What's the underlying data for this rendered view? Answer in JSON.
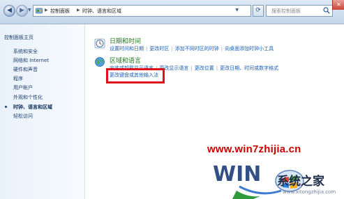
{
  "toolbar": {
    "breadcrumb": [
      "控制面板",
      "时钟、语言和区域"
    ],
    "search_placeholder": "搜索控制面板",
    "close_glyph": "✕",
    "back_glyph": "◀",
    "forward_glyph": "▶",
    "refresh_glyph": "⟳"
  },
  "sidebar": {
    "home": "控制面板主页",
    "items": [
      {
        "label": "系统和安全"
      },
      {
        "label": "网络和 Internet"
      },
      {
        "label": "硬件和声音"
      },
      {
        "label": "程序"
      },
      {
        "label": "用户帐户"
      },
      {
        "label": "外观和个性化"
      },
      {
        "label": "时钟、语言和区域",
        "current": true
      },
      {
        "label": "轻松访问"
      }
    ]
  },
  "categories": [
    {
      "title": "日期和时间",
      "icon": "clock-icon",
      "links": [
        "设置时间和日期",
        "更改时区",
        "添加不同时区的时钟",
        "向桌面添加时钟小工具"
      ]
    },
    {
      "title": "区域和语言",
      "icon": "globe-icon",
      "links": [
        "安装或卸载显示语言",
        "更改显示语言",
        "更改位置",
        "更改日期、时间或数字格式"
      ],
      "highlighted_link": "更改键盘或其他输入法"
    }
  ],
  "highlight_color": "#e0101a",
  "watermark": {
    "url": "www.win7zhijia.cn",
    "brand": "系统之家",
    "small": "www.xitongzhijia.com"
  }
}
